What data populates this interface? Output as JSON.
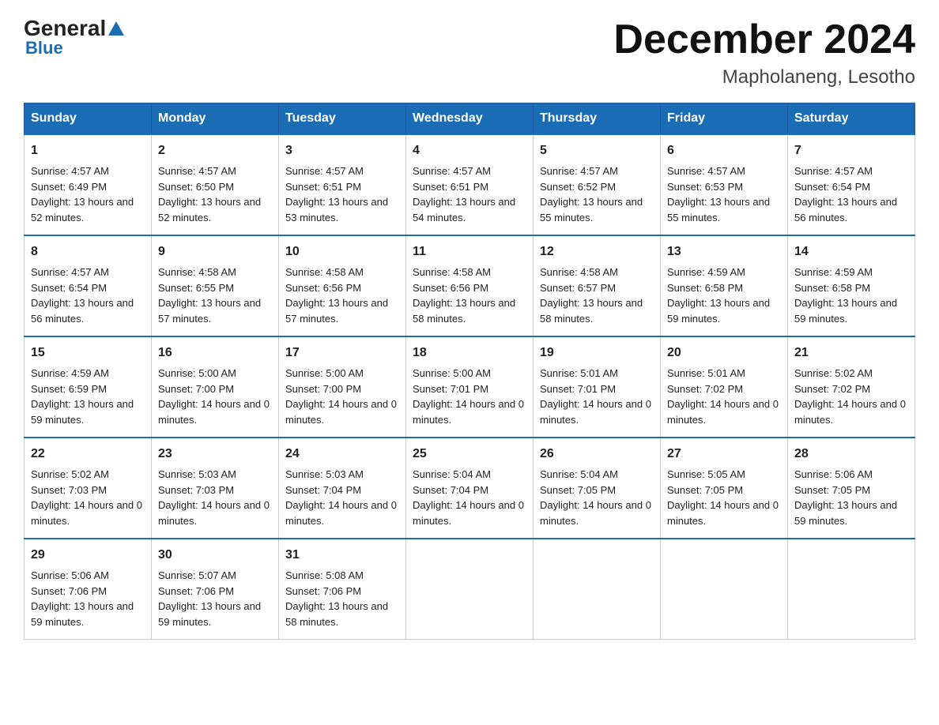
{
  "header": {
    "logo_general": "General",
    "logo_blue": "Blue",
    "month_title": "December 2024",
    "location": "Mapholaneng, Lesotho"
  },
  "weekdays": [
    "Sunday",
    "Monday",
    "Tuesday",
    "Wednesday",
    "Thursday",
    "Friday",
    "Saturday"
  ],
  "weeks": [
    [
      {
        "day": "1",
        "sunrise": "4:57 AM",
        "sunset": "6:49 PM",
        "daylight": "13 hours and 52 minutes."
      },
      {
        "day": "2",
        "sunrise": "4:57 AM",
        "sunset": "6:50 PM",
        "daylight": "13 hours and 52 minutes."
      },
      {
        "day": "3",
        "sunrise": "4:57 AM",
        "sunset": "6:51 PM",
        "daylight": "13 hours and 53 minutes."
      },
      {
        "day": "4",
        "sunrise": "4:57 AM",
        "sunset": "6:51 PM",
        "daylight": "13 hours and 54 minutes."
      },
      {
        "day": "5",
        "sunrise": "4:57 AM",
        "sunset": "6:52 PM",
        "daylight": "13 hours and 55 minutes."
      },
      {
        "day": "6",
        "sunrise": "4:57 AM",
        "sunset": "6:53 PM",
        "daylight": "13 hours and 55 minutes."
      },
      {
        "day": "7",
        "sunrise": "4:57 AM",
        "sunset": "6:54 PM",
        "daylight": "13 hours and 56 minutes."
      }
    ],
    [
      {
        "day": "8",
        "sunrise": "4:57 AM",
        "sunset": "6:54 PM",
        "daylight": "13 hours and 56 minutes."
      },
      {
        "day": "9",
        "sunrise": "4:58 AM",
        "sunset": "6:55 PM",
        "daylight": "13 hours and 57 minutes."
      },
      {
        "day": "10",
        "sunrise": "4:58 AM",
        "sunset": "6:56 PM",
        "daylight": "13 hours and 57 minutes."
      },
      {
        "day": "11",
        "sunrise": "4:58 AM",
        "sunset": "6:56 PM",
        "daylight": "13 hours and 58 minutes."
      },
      {
        "day": "12",
        "sunrise": "4:58 AM",
        "sunset": "6:57 PM",
        "daylight": "13 hours and 58 minutes."
      },
      {
        "day": "13",
        "sunrise": "4:59 AM",
        "sunset": "6:58 PM",
        "daylight": "13 hours and 59 minutes."
      },
      {
        "day": "14",
        "sunrise": "4:59 AM",
        "sunset": "6:58 PM",
        "daylight": "13 hours and 59 minutes."
      }
    ],
    [
      {
        "day": "15",
        "sunrise": "4:59 AM",
        "sunset": "6:59 PM",
        "daylight": "13 hours and 59 minutes."
      },
      {
        "day": "16",
        "sunrise": "5:00 AM",
        "sunset": "7:00 PM",
        "daylight": "14 hours and 0 minutes."
      },
      {
        "day": "17",
        "sunrise": "5:00 AM",
        "sunset": "7:00 PM",
        "daylight": "14 hours and 0 minutes."
      },
      {
        "day": "18",
        "sunrise": "5:00 AM",
        "sunset": "7:01 PM",
        "daylight": "14 hours and 0 minutes."
      },
      {
        "day": "19",
        "sunrise": "5:01 AM",
        "sunset": "7:01 PM",
        "daylight": "14 hours and 0 minutes."
      },
      {
        "day": "20",
        "sunrise": "5:01 AM",
        "sunset": "7:02 PM",
        "daylight": "14 hours and 0 minutes."
      },
      {
        "day": "21",
        "sunrise": "5:02 AM",
        "sunset": "7:02 PM",
        "daylight": "14 hours and 0 minutes."
      }
    ],
    [
      {
        "day": "22",
        "sunrise": "5:02 AM",
        "sunset": "7:03 PM",
        "daylight": "14 hours and 0 minutes."
      },
      {
        "day": "23",
        "sunrise": "5:03 AM",
        "sunset": "7:03 PM",
        "daylight": "14 hours and 0 minutes."
      },
      {
        "day": "24",
        "sunrise": "5:03 AM",
        "sunset": "7:04 PM",
        "daylight": "14 hours and 0 minutes."
      },
      {
        "day": "25",
        "sunrise": "5:04 AM",
        "sunset": "7:04 PM",
        "daylight": "14 hours and 0 minutes."
      },
      {
        "day": "26",
        "sunrise": "5:04 AM",
        "sunset": "7:05 PM",
        "daylight": "14 hours and 0 minutes."
      },
      {
        "day": "27",
        "sunrise": "5:05 AM",
        "sunset": "7:05 PM",
        "daylight": "14 hours and 0 minutes."
      },
      {
        "day": "28",
        "sunrise": "5:06 AM",
        "sunset": "7:05 PM",
        "daylight": "13 hours and 59 minutes."
      }
    ],
    [
      {
        "day": "29",
        "sunrise": "5:06 AM",
        "sunset": "7:06 PM",
        "daylight": "13 hours and 59 minutes."
      },
      {
        "day": "30",
        "sunrise": "5:07 AM",
        "sunset": "7:06 PM",
        "daylight": "13 hours and 59 minutes."
      },
      {
        "day": "31",
        "sunrise": "5:08 AM",
        "sunset": "7:06 PM",
        "daylight": "13 hours and 58 minutes."
      },
      null,
      null,
      null,
      null
    ]
  ]
}
